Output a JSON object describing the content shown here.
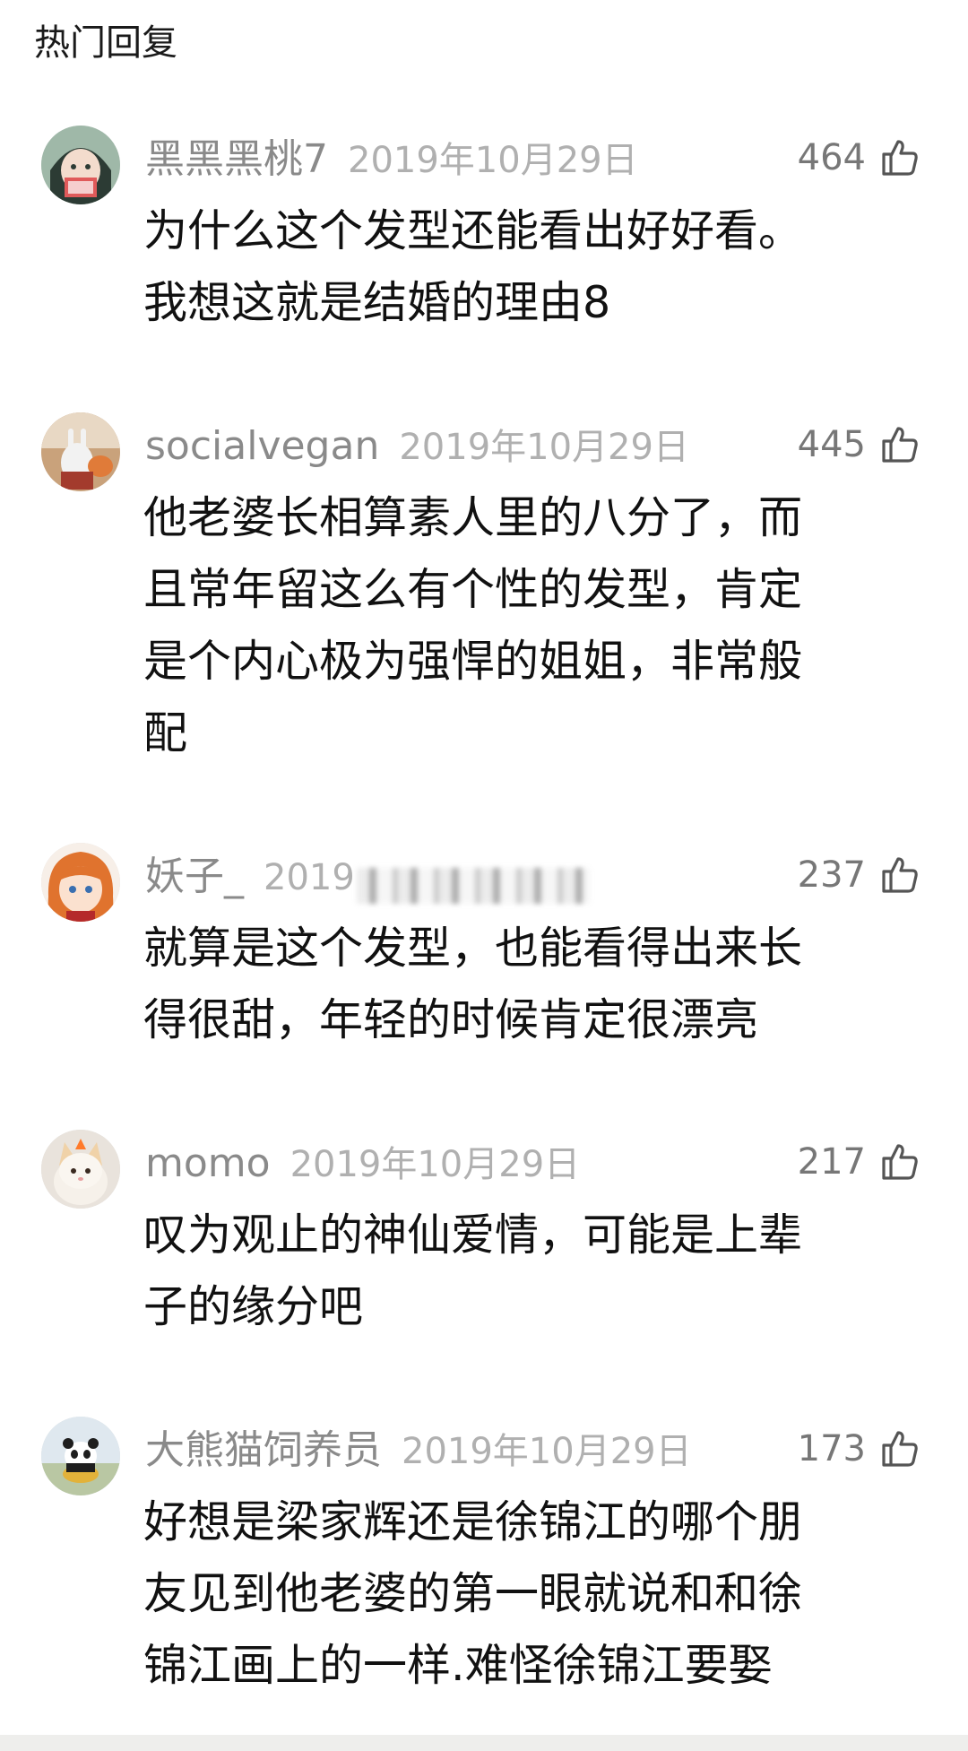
{
  "section_title": "热门回复",
  "comments": [
    {
      "username": "黑黑黑桃7",
      "date": "2019年10月29日",
      "likes": "464",
      "lines": [
        "为什么这个发型还能看出好好看。",
        "我想这就是结婚的理由8"
      ]
    },
    {
      "username": "socialvegan",
      "date": "2019年10月29日",
      "likes": "445",
      "lines": [
        "他老婆长相算素人里的八分了，而",
        "且常年留这么有个性的发型，肯定",
        "是个内心极为强悍的姐姐，非常般",
        "配"
      ]
    },
    {
      "username": "妖子_",
      "date": "2019",
      "likes": "237",
      "lines": [
        "就算是这个发型，也能看得出来长",
        "得很甜，年轻的时候肯定很漂亮"
      ]
    },
    {
      "username": "momo",
      "date": "2019年10月29日",
      "likes": "217",
      "lines": [
        "叹为观止的神仙爱情，可能是上辈",
        "子的缘分吧"
      ]
    },
    {
      "username": "大熊猫饲养员",
      "date": "2019年10月29日",
      "likes": "173",
      "lines": [
        "好想是梁家辉还是徐锦江的哪个朋",
        "友见到他老婆的第一眼就说和和徐",
        "锦江画上的一样.难怪徐锦江要娶"
      ]
    }
  ]
}
